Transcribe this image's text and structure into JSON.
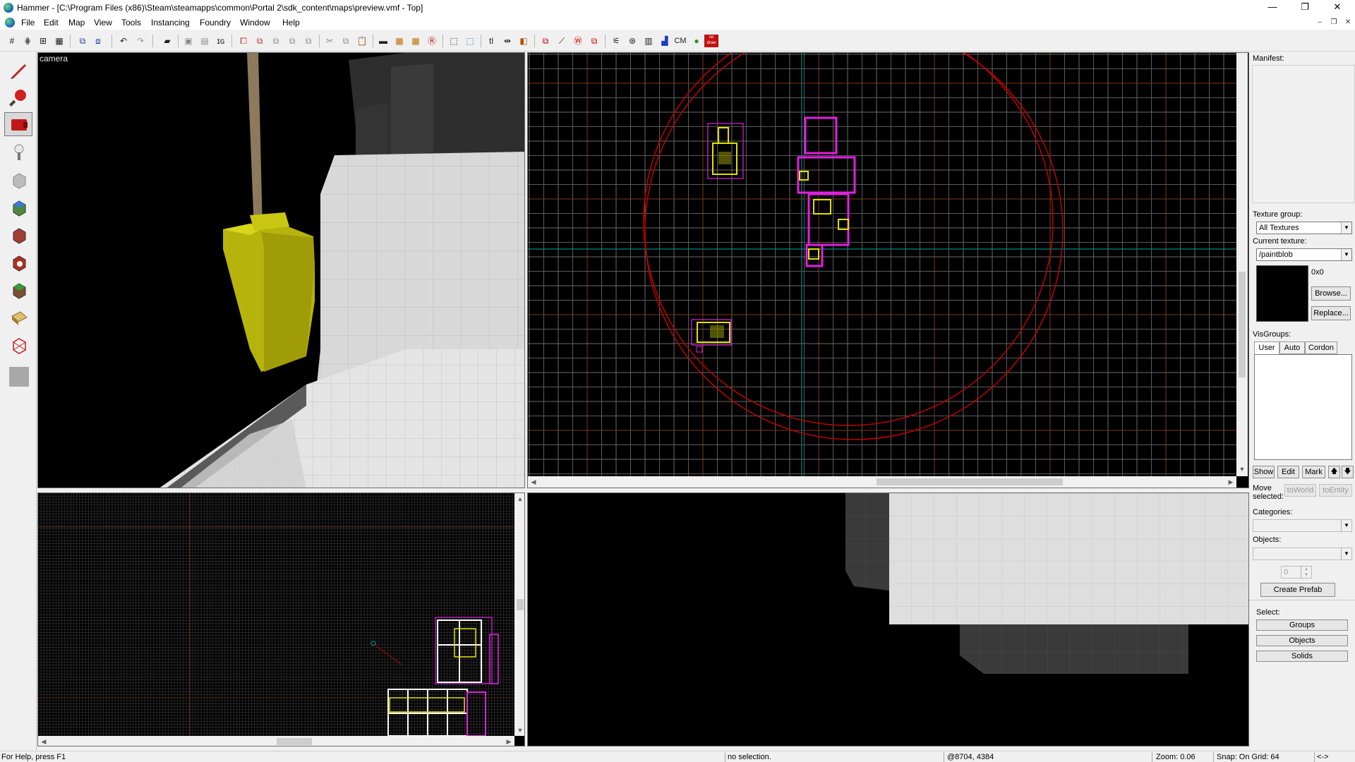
{
  "window": {
    "title": "Hammer - [C:\\Program Files (x86)\\Steam\\steamapps\\common\\Portal 2\\sdk_content\\maps\\preview.vmf - Top]",
    "minimize": "—",
    "maximize": "❐",
    "close": "✕"
  },
  "menu": {
    "items": [
      "File",
      "Edit",
      "Map",
      "View",
      "Tools",
      "Instancing",
      "Foundry",
      "Window",
      "Help"
    ],
    "mdi_minimize": "–",
    "mdi_restore": "❐",
    "mdi_close": "✕"
  },
  "toolbar": {
    "cm_label": "CM",
    "nodraw_label": "no draw"
  },
  "viewports": {
    "camera_label": "camera"
  },
  "right_panel": {
    "manifest_label": "Manifest:",
    "texture_group_label": "Texture group:",
    "texture_group_value": "All Textures",
    "current_texture_label": "Current texture:",
    "current_texture_value": "/paintblob",
    "texture_size": "0x0",
    "browse_button": "Browse...",
    "replace_button": "Replace...",
    "visgroups_label": "VisGroups:",
    "tabs": [
      "User",
      "Auto",
      "Cordon"
    ],
    "show_button": "Show",
    "edit_button": "Edit",
    "mark_button": "Mark",
    "up_arrow": "🡅",
    "down_arrow": "🡇",
    "move_selected_label": "Move selected:",
    "toworld_button": "toWorld",
    "toentity_button": "toEntity",
    "categories_label": "Categories:",
    "objects_label": "Objects:",
    "prefab_count": "0",
    "create_prefab_button": "Create Prefab",
    "select_label": "Select:",
    "groups_button": "Groups",
    "objects_button": "Objects",
    "solids_button": "Solids"
  },
  "statusbar": {
    "help": "For Help, press F1",
    "selection": "no selection.",
    "coords": "@8704, 4384",
    "zoom": "Zoom: 0.06",
    "snap": "Snap: On Grid: 64",
    "arrows": "<->"
  },
  "colors": {
    "viewport_bg": "#000000",
    "grid_minor": "#3a3a3a",
    "grid_major": "#7a3a1a",
    "axis": "#008888",
    "brush_yellow": "#e0e000",
    "brush_magenta": "#e020e0",
    "entity_circle": "#c00000"
  }
}
